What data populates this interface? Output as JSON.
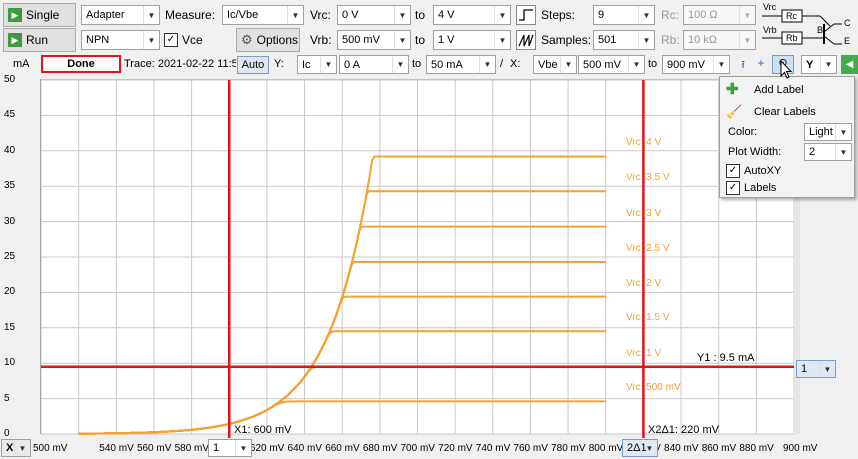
{
  "toolbar": {
    "single_label": "Single",
    "run_label": "Run",
    "device_select": "Adapter",
    "polarity_select": "NPN",
    "vce_checkbox_label": "Vce",
    "vce_checked": true,
    "measure_label": "Measure:",
    "measure_select": "Ic/Vbe",
    "options_label": "Options",
    "vrc_label": "Vrc:",
    "vrc_from": "0 V",
    "vrc_to_label": "to",
    "vrc_to": "4 V",
    "vrb_label": "Vrb:",
    "vrb_from": "500 mV",
    "vrb_to_label": "to",
    "vrb_to": "1 V",
    "steps_label": "Steps:",
    "steps_value": "9",
    "samples_label": "Samples:",
    "samples_value": "501",
    "rc_label": "Rc:",
    "rc_value": "100 Ω",
    "rb_label": "Rb:",
    "rb_value": "10 kΩ",
    "schematic_vrc": "Vrc",
    "schematic_rc": "Rc",
    "schematic_vrb": "Vrb",
    "schematic_rb": "Rb",
    "schematic_c": "C",
    "schematic_b": "B",
    "schematic_e": "E"
  },
  "axisbar": {
    "y_unit": "mA",
    "status": "Done",
    "trace_label": "Trace: 2021-02-22 11:5",
    "auto_label": "Auto",
    "y_label": "Y:",
    "y_select": "Ic",
    "y_from": "0 A",
    "y_to_label": "to",
    "y_to": "50 mA",
    "x_sep": "/",
    "x_label": "X:",
    "x_select": "Vbe",
    "x_from": "500 mV",
    "x_to_label": "to",
    "x_to": "900 mV",
    "y_dropdown": "Y"
  },
  "popup_menu": {
    "add_label": "Add Label",
    "clear_labels": "Clear Labels",
    "color_label": "Color:",
    "color_value": "Light",
    "plot_width_label": "Plot Width:",
    "plot_width_value": "2",
    "autoxy_label": "AutoXY",
    "autoxy_checked": true,
    "labels_label": "Labels",
    "labels_checked": true
  },
  "cursors": {
    "x1_label": "X1: 600 mV",
    "x2_label": "X2Δ1: 220 mV",
    "y1_label": "Y1 : 9.5 mA",
    "y_cursor_select": "1",
    "x_cursor_select": "1",
    "x2_cursor_select": "2Δ1",
    "x_axis_selector": "X"
  },
  "colors": {
    "curve": "#f5a030",
    "cursor": "#e8101a",
    "grid": "#c8c8c8"
  },
  "chart_data": {
    "type": "line",
    "xlabel": "",
    "ylabel": "mA",
    "xlim": [
      500,
      900
    ],
    "ylim": [
      0,
      50
    ],
    "x_ticks": [
      "500 mV",
      "540 mV",
      "560 mV",
      "580 mV",
      "600 mV",
      "620 mV",
      "640 mV",
      "660 mV",
      "680 mV",
      "700 mV",
      "720 mV",
      "740 mV",
      "760 mV",
      "780 mV",
      "800 mV",
      "820 mV",
      "840 mV",
      "860 mV",
      "880 mV",
      "900 mV"
    ],
    "x_tick_values": [
      500,
      540,
      560,
      580,
      600,
      620,
      640,
      660,
      680,
      700,
      720,
      740,
      760,
      780,
      800,
      820,
      840,
      860,
      880,
      900
    ],
    "y_ticks": [
      "0",
      "5",
      "10",
      "15",
      "20",
      "25",
      "30",
      "35",
      "40",
      "45",
      "50"
    ],
    "y_tick_values": [
      0,
      5,
      10,
      15,
      20,
      25,
      30,
      35,
      40,
      45,
      50
    ],
    "series": [
      {
        "name": "Vrc: 500 mV",
        "plateau": 4.6
      },
      {
        "name": "Vrc: 1 V",
        "plateau": 9.5
      },
      {
        "name": "Vrc: 1.5 V",
        "plateau": 14.5
      },
      {
        "name": "Vrc: 2 V",
        "plateau": 19.4
      },
      {
        "name": "Vrc: 2.5 V",
        "plateau": 24.3
      },
      {
        "name": "Vrc: 3 V",
        "plateau": 29.3
      },
      {
        "name": "Vrc: 3.5 V",
        "plateau": 34.3
      },
      {
        "name": "Vrc: 4 V",
        "plateau": 39.2
      }
    ],
    "cursor_x1": 600,
    "cursor_x2": 820,
    "cursor_y1": 9.5
  }
}
